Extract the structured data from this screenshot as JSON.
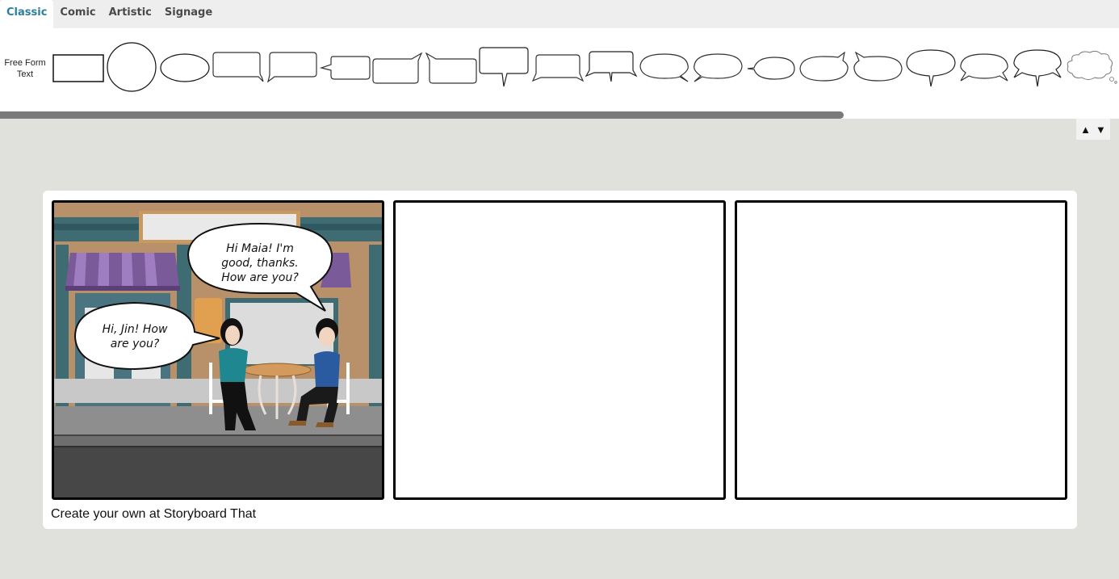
{
  "tabs": [
    {
      "label": "Classic",
      "active": true
    },
    {
      "label": "Comic",
      "active": false
    },
    {
      "label": "Artistic",
      "active": false
    },
    {
      "label": "Signage",
      "active": false
    }
  ],
  "shelf": {
    "free_form_text_label": "Free Form Text",
    "shapes": [
      "rectangle",
      "circle",
      "ellipse",
      "rounded-rect-tail-bottom-right",
      "rounded-rect-tail-bottom-left",
      "rounded-rect-tail-left",
      "rounded-rect-tail-top-right",
      "rounded-rect-tail-top-left",
      "rounded-rect-tail-bottom-center",
      "rounded-rect-two-tails",
      "rounded-rect-three-tails",
      "oval-tail-bottom-right",
      "oval-tail-bottom-left",
      "oval-tail-left",
      "oval-tail-top-right",
      "oval-tail-top-left",
      "oval-tail-bottom-center",
      "oval-two-tails",
      "oval-three-tails",
      "thought-cloud"
    ]
  },
  "scroll_controls": {
    "up_icon": "▲",
    "down_icon": "▼"
  },
  "storyboard": {
    "cells": [
      {
        "scene": "cafe storefront with purple awnings, two characters seated at a round table",
        "bubbles": [
          {
            "speaker": "Jin",
            "lines": [
              "Hi Maia! I'm",
              "good, thanks.",
              "How are you?"
            ]
          },
          {
            "speaker": "Maia",
            "lines": [
              "Hi, Jin! How",
              "are you?"
            ]
          }
        ]
      },
      {
        "scene": "empty",
        "bubbles": []
      },
      {
        "scene": "empty",
        "bubbles": []
      }
    ],
    "credit": "Create your own at Storyboard That"
  },
  "colors": {
    "active_tab": "#2a7fa0",
    "workspace_bg": "#e0e0dc",
    "awning": "#7b5a9a",
    "wall": "#b8906a",
    "teal_trim": "#3f6b73",
    "sidewalk": "#8a8a8a",
    "street": "#474747"
  }
}
